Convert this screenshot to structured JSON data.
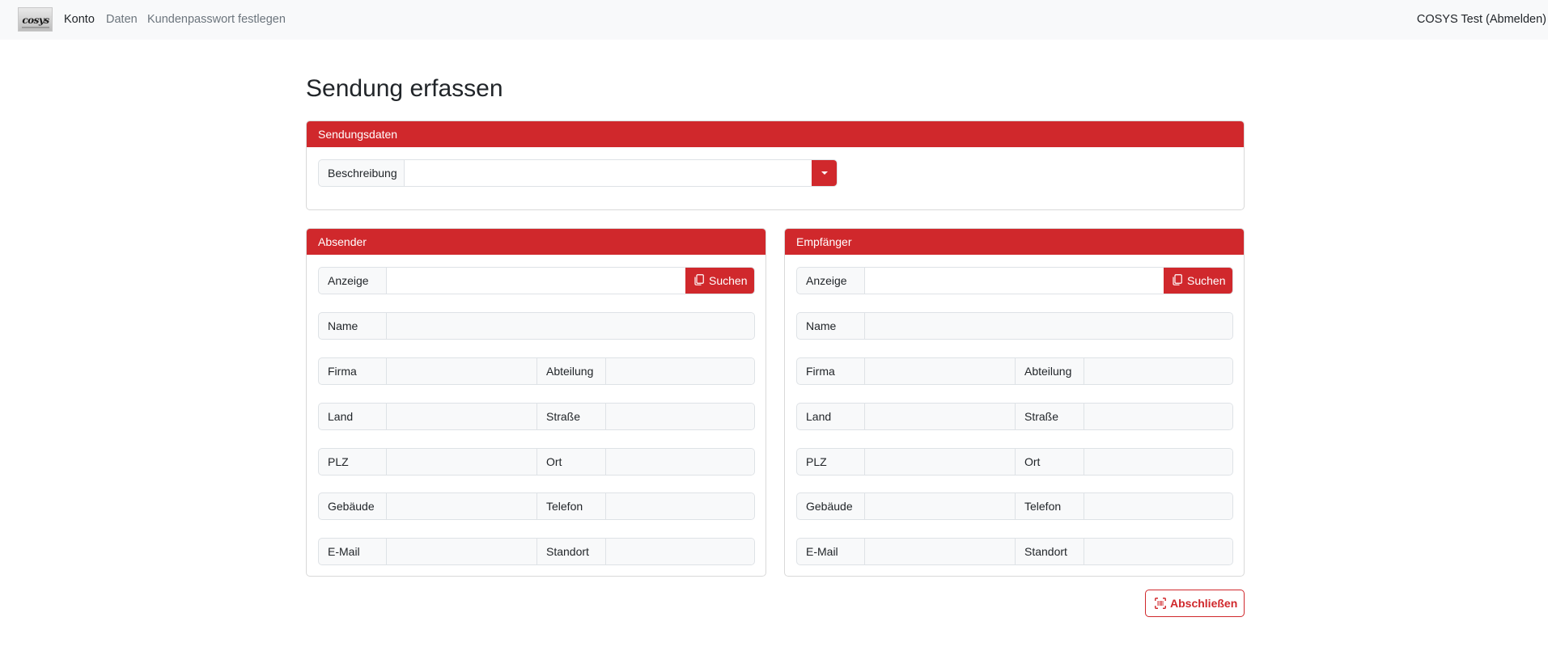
{
  "nav": {
    "logo_text": "cosys",
    "links": [
      "Konto",
      "Daten",
      "Kundenpasswort festlegen"
    ],
    "user": "COSYS Test (Abmelden)"
  },
  "page_title": "Sendung erfassen",
  "sendungsdaten": {
    "header": "Sendungsdaten",
    "beschreibung_label": "Beschreibung",
    "beschreibung_value": ""
  },
  "absender": {
    "header": "Absender",
    "anzeige_label": "Anzeige",
    "search_label": "Suchen",
    "name_label": "Name",
    "firma_label": "Firma",
    "abteilung_label": "Abteilung",
    "land_label": "Land",
    "strasse_label": "Straße",
    "plz_label": "PLZ",
    "ort_label": "Ort",
    "gebaeude_label": "Gebäude",
    "telefon_label": "Telefon",
    "email_label": "E-Mail",
    "standort_label": "Standort"
  },
  "empfaenger": {
    "header": "Empfänger",
    "anzeige_label": "Anzeige",
    "search_label": "Suchen",
    "name_label": "Name",
    "firma_label": "Firma",
    "abteilung_label": "Abteilung",
    "land_label": "Land",
    "strasse_label": "Straße",
    "plz_label": "PLZ",
    "ort_label": "Ort",
    "gebaeude_label": "Gebäude",
    "telefon_label": "Telefon",
    "email_label": "E-Mail",
    "standort_label": "Standort"
  },
  "finish_button": "Abschließen",
  "colors": {
    "accent": "#d0282c",
    "navbar_bg": "#f8f9fa",
    "input_bg": "#f8f9fa",
    "border": "#dee2e6"
  },
  "icons": {
    "search_button": "copy-icon",
    "finish_button": "barcode-scan-icon",
    "dropdown": "caret-down-icon"
  }
}
